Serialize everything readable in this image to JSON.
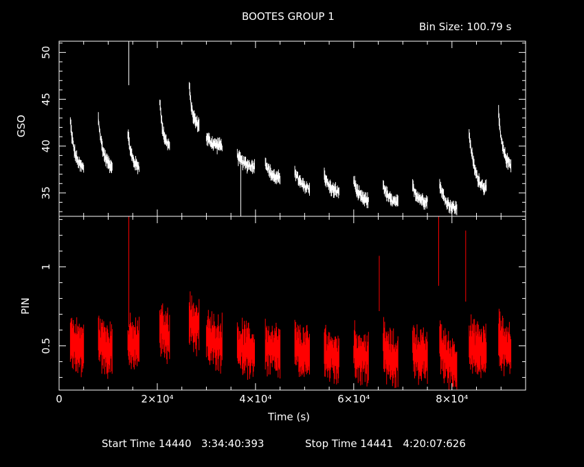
{
  "header": {
    "title": "BOOTES GROUP 1",
    "bin_size": "Bin Size: 100.79 s"
  },
  "footer": {
    "start_time": "Start Time 14440   3:34:40:393",
    "stop_time": "Stop Time 14441   4:20:07:626"
  },
  "colors": {
    "background": "#000000",
    "axes": "#ffffff",
    "gso_series": "#ffffff",
    "pin_series": "#ff0000"
  },
  "chart_data": [
    {
      "type": "line",
      "title": "BOOTES GROUP 1",
      "ylabel": "GSO",
      "xlabel": "",
      "xlim": [
        0,
        95000
      ],
      "ylim": [
        32.5,
        51.2
      ],
      "yticks": [
        35,
        40,
        45,
        50
      ],
      "ytick_labels": [
        "35",
        "40",
        "45",
        "50"
      ],
      "series": [
        {
          "color": "#ffffff",
          "segments": [
            {
              "x": [
                2300,
                5000
              ],
              "y": [
                42.6,
                37.4
              ]
            },
            {
              "x": [
                8000,
                10800
              ],
              "y": [
                43.0,
                37.6
              ]
            },
            {
              "x": [
                14000,
                16300
              ],
              "y": [
                41.5,
                37.6
              ]
            },
            {
              "x": [
                20500,
                22500
              ],
              "y": [
                44.9,
                39.8
              ]
            },
            {
              "x": [
                26500,
                28500
              ],
              "y": [
                46.4,
                42.0
              ]
            },
            {
              "x": [
                30000,
                33200
              ],
              "y": [
                41.0,
                40.0
              ]
            },
            {
              "x": [
                36300,
                39800
              ],
              "y": [
                39.0,
                37.8
              ]
            },
            {
              "x": [
                42000,
                45000
              ],
              "y": [
                38.5,
                36.4
              ]
            },
            {
              "x": [
                48000,
                51000
              ],
              "y": [
                37.5,
                35.4
              ]
            },
            {
              "x": [
                54000,
                57000
              ],
              "y": [
                37.0,
                35.0
              ]
            },
            {
              "x": [
                60000,
                63000
              ],
              "y": [
                36.4,
                34.0
              ]
            },
            {
              "x": [
                66000,
                69000
              ],
              "y": [
                36.0,
                33.8
              ]
            },
            {
              "x": [
                72000,
                75000
              ],
              "y": [
                35.8,
                34.0
              ]
            },
            {
              "x": [
                77500,
                81000
              ],
              "y": [
                36.0,
                33.2
              ]
            },
            {
              "x": [
                83500,
                87000
              ],
              "y": [
                41.5,
                35.2
              ]
            },
            {
              "x": [
                89500,
                92000
              ],
              "y": [
                43.4,
                37.8
              ]
            }
          ],
          "spikes": [
            {
              "x": 14200,
              "y1": 46.5,
              "y2": 51.2
            },
            {
              "x": 37000,
              "y1": 39.0,
              "y2": 32.5
            }
          ]
        }
      ]
    },
    {
      "type": "line",
      "xlabel": "Time (s)",
      "ylabel": "PIN",
      "xlim": [
        0,
        95000
      ],
      "ylim": [
        0.22,
        1.32
      ],
      "yticks": [
        0.5,
        1
      ],
      "ytick_labels": [
        "0.5",
        "1"
      ],
      "xticks": [
        0,
        20000,
        40000,
        60000,
        80000
      ],
      "xtick_labels": [
        "0",
        "2×10⁴",
        "4×10⁴",
        "6×10⁴",
        "8×10⁴"
      ],
      "series": [
        {
          "color": "#ff0000",
          "segments": [
            {
              "x": [
                2300,
                5000
              ],
              "y": [
                0.55,
                0.48
              ]
            },
            {
              "x": [
                8000,
                10800
              ],
              "y": [
                0.55,
                0.48
              ]
            },
            {
              "x": [
                14000,
                16300
              ],
              "y": [
                0.52,
                0.5
              ]
            },
            {
              "x": [
                20500,
                22500
              ],
              "y": [
                0.63,
                0.56
              ]
            },
            {
              "x": [
                26500,
                28500
              ],
              "y": [
                0.68,
                0.62
              ]
            },
            {
              "x": [
                30000,
                33200
              ],
              "y": [
                0.55,
                0.52
              ]
            },
            {
              "x": [
                36300,
                39800
              ],
              "y": [
                0.52,
                0.46
              ]
            },
            {
              "x": [
                42000,
                45000
              ],
              "y": [
                0.5,
                0.46
              ]
            },
            {
              "x": [
                48000,
                51000
              ],
              "y": [
                0.5,
                0.44
              ]
            },
            {
              "x": [
                54000,
                57000
              ],
              "y": [
                0.48,
                0.42
              ]
            },
            {
              "x": [
                60000,
                63000
              ],
              "y": [
                0.48,
                0.42
              ]
            },
            {
              "x": [
                66000,
                69000
              ],
              "y": [
                0.5,
                0.4
              ]
            },
            {
              "x": [
                72000,
                75000
              ],
              "y": [
                0.5,
                0.42
              ]
            },
            {
              "x": [
                77500,
                81000
              ],
              "y": [
                0.52,
                0.38
              ]
            },
            {
              "x": [
                83500,
                87000
              ],
              "y": [
                0.52,
                0.46
              ]
            },
            {
              "x": [
                89500,
                92000
              ],
              "y": [
                0.56,
                0.48
              ]
            }
          ],
          "spikes": [
            {
              "x": 14200,
              "y1": 0.62,
              "y2": 1.32
            },
            {
              "x": 65200,
              "y1": 0.72,
              "y2": 1.07
            },
            {
              "x": 77300,
              "y1": 0.88,
              "y2": 1.32
            },
            {
              "x": 82800,
              "y1": 0.78,
              "y2": 1.23
            }
          ]
        }
      ]
    }
  ]
}
